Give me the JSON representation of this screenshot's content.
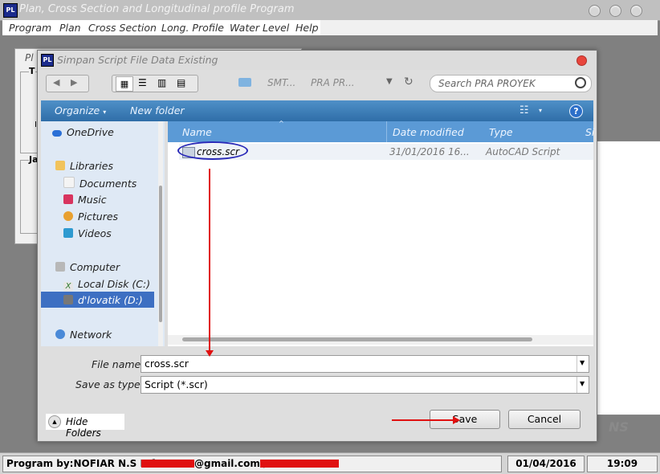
{
  "app": {
    "title": "Plan, Cross Section and Longitudinal profile Program",
    "icon_text": "PL",
    "menu": [
      "Program",
      "Plan",
      "Cross Section",
      "Long. Profile",
      "Water Level",
      "Help"
    ],
    "bg_labels": [
      "Pl",
      "T",
      "I",
      "Ja"
    ],
    "watermark": "NS"
  },
  "dialog": {
    "title": "Simpan Script File Data Existing",
    "breadcrumb": [
      "SMT...",
      "PRA PR..."
    ],
    "search_placeholder": "Search PRA PROYEK",
    "organize_label": "Organize",
    "new_folder_label": "New folder",
    "nav_items": [
      "OneDrive",
      "Libraries",
      "Documents",
      "Music",
      "Pictures",
      "Videos",
      "Computer",
      "Local Disk (C:)",
      "d'lovatik (D:)",
      "Network"
    ],
    "columns": [
      "Name",
      "Date modified",
      "Type",
      "Si"
    ],
    "file": {
      "name": "cross.scr",
      "date": "31/01/2016 16...",
      "type": "AutoCAD Script"
    },
    "file_name_label": "File name:",
    "file_name_value": "cross.scr",
    "save_type_label": "Save as type:",
    "save_type_value": "Script (*.scr)",
    "hide_folders_label": "Hide Folders",
    "save_label": "Save",
    "cancel_label": "Cancel"
  },
  "status": {
    "program_by": "Program by:NOFIAR N.S Info:",
    "email_suffix": "@gmail.com /",
    "date": "01/04/2016",
    "time": "19:09"
  },
  "colors": {
    "accent_blue": "#3a7ab8",
    "annotation_red": "#e01010",
    "selection": "#3d6fc2"
  }
}
